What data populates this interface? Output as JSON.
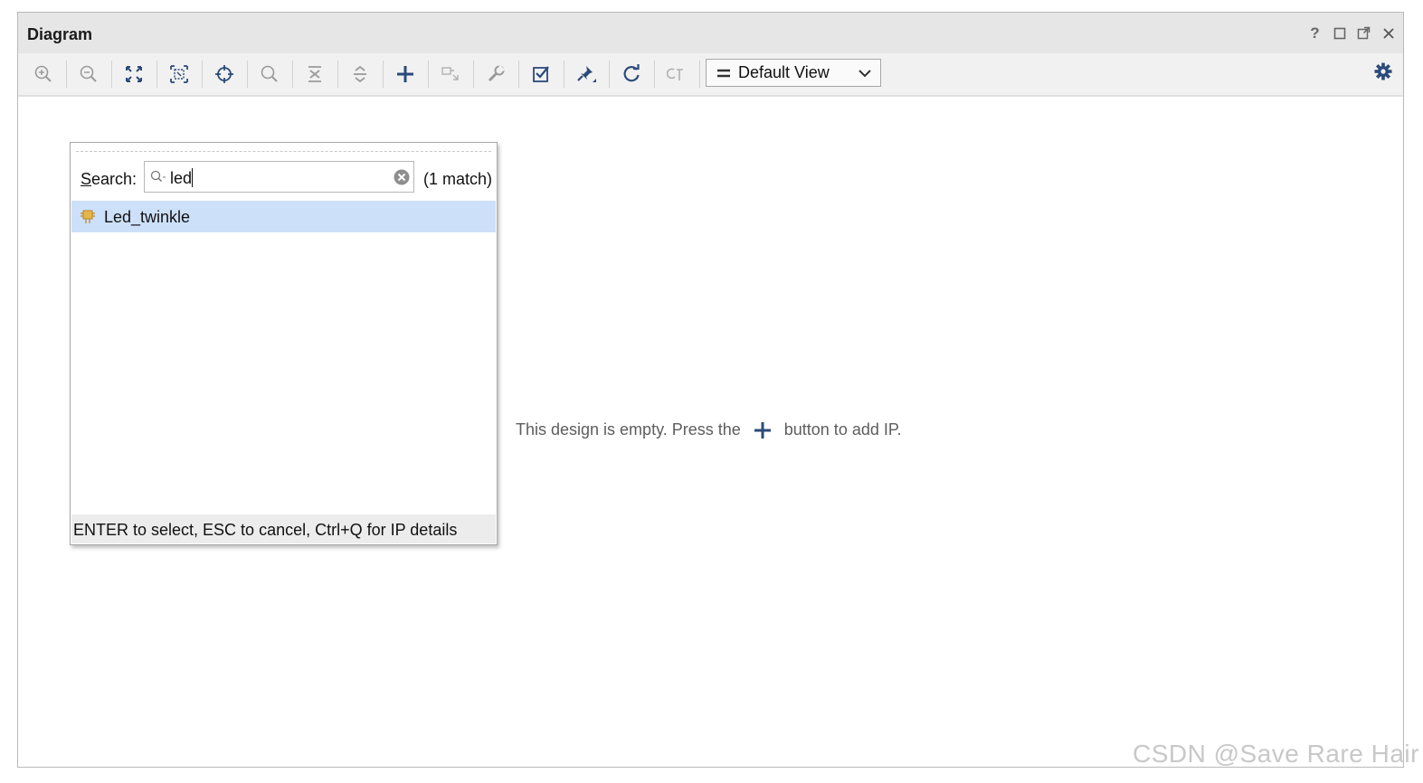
{
  "window": {
    "title": "Diagram",
    "controls": [
      "help-icon",
      "maximize-icon",
      "float-icon",
      "close-icon"
    ]
  },
  "toolbar": {
    "buttons": [
      "zoom-in-icon",
      "zoom-out-icon",
      "fit-full-icon",
      "fit-selection-icon",
      "auto-connect-icon",
      "search-icon",
      "collapse-all-icon",
      "expand-all-icon",
      "add-ip-icon",
      "add-module-icon",
      "properties-icon",
      "validate-design-icon",
      "pin-icon",
      "regenerate-layout-icon",
      "optimize-routing-icon"
    ],
    "view_select": {
      "selected": "Default View"
    },
    "settings_icon": "gear-icon"
  },
  "popup": {
    "search_label_underlined": "S",
    "search_label_rest": "earch:",
    "search_value": "led",
    "match_count": "(1 match)",
    "results": [
      {
        "name": "Led_twinkle",
        "icon": "ip-core-icon"
      }
    ],
    "footer_hint": "ENTER to select, ESC to cancel, Ctrl+Q for IP details"
  },
  "canvas": {
    "empty_before": "This design is empty. Press the",
    "empty_after": "button to add IP."
  },
  "watermark": "CSDN @Save Rare Hair",
  "colors": {
    "accent": "#2b4a7a",
    "selection": "#cde0fa",
    "toolbar_bg": "#f1f1f1"
  }
}
